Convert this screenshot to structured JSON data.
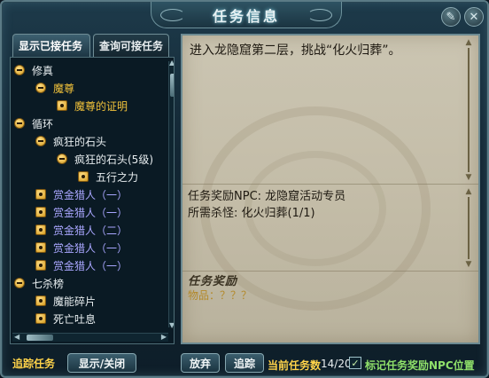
{
  "window": {
    "title": "任务信息",
    "close_icon_glyph": "✕",
    "settings_icon_glyph": "✎"
  },
  "tabs": {
    "accepted": "显示已接任务",
    "available": "查询可接任务"
  },
  "tree": {
    "items": [
      {
        "label": "修真",
        "indent": 0,
        "kind": "toggle",
        "color": "white"
      },
      {
        "label": "魔尊",
        "indent": 1,
        "kind": "toggle",
        "color": "gold"
      },
      {
        "label": "魔尊的证明",
        "indent": 2,
        "kind": "bullet",
        "color": "gold"
      },
      {
        "label": "循环",
        "indent": 0,
        "kind": "toggle",
        "color": "white"
      },
      {
        "label": "疯狂的石头",
        "indent": 1,
        "kind": "toggle",
        "color": "white"
      },
      {
        "label": "疯狂的石头(5级)",
        "indent": 2,
        "kind": "toggle",
        "color": "white"
      },
      {
        "label": "五行之力",
        "indent": 3,
        "kind": "bullet",
        "color": "white"
      },
      {
        "label": "赏金猎人（一）",
        "indent": 1,
        "kind": "bullet",
        "color": "purple"
      },
      {
        "label": "赏金猎人（一）",
        "indent": 1,
        "kind": "bullet",
        "color": "purple"
      },
      {
        "label": "赏金猎人（二）",
        "indent": 1,
        "kind": "bullet",
        "color": "purple"
      },
      {
        "label": "赏金猎人（一）",
        "indent": 1,
        "kind": "bullet",
        "color": "purple"
      },
      {
        "label": "赏金猎人（一）",
        "indent": 1,
        "kind": "bullet",
        "color": "purple"
      },
      {
        "label": "七杀榜",
        "indent": 0,
        "kind": "toggle",
        "color": "white"
      },
      {
        "label": "魔能碎片",
        "indent": 1,
        "kind": "bullet",
        "color": "white"
      },
      {
        "label": "死亡吐息",
        "indent": 1,
        "kind": "bullet",
        "color": "white"
      }
    ]
  },
  "details": {
    "description": "进入龙隐窟第二层，挑战“化火归葬”。",
    "npc_line": "任务奖励NPC: 龙隐窟活动专员",
    "kill_line": "所需杀怪: 化火归葬(1/1)",
    "reward_heading": "任务奖励",
    "reward_item": "物品：？？？"
  },
  "bottom": {
    "track_label": "追踪任务",
    "show_hide_button": "显示/关闭",
    "abandon_button": "放弃",
    "track_button": "追踪",
    "count_label": "当前任务数",
    "count_value": "14/20",
    "npc_mark_label": "标记任务奖励NPC位置",
    "npc_mark_checked": true
  },
  "colors": {
    "gold": "#f0c13a",
    "purple": "#a9a6ff",
    "white": "#e8eef0",
    "parchment": "#c3bca7",
    "label_green": "#8fe06a",
    "label_yellow": "#ffd34a"
  }
}
